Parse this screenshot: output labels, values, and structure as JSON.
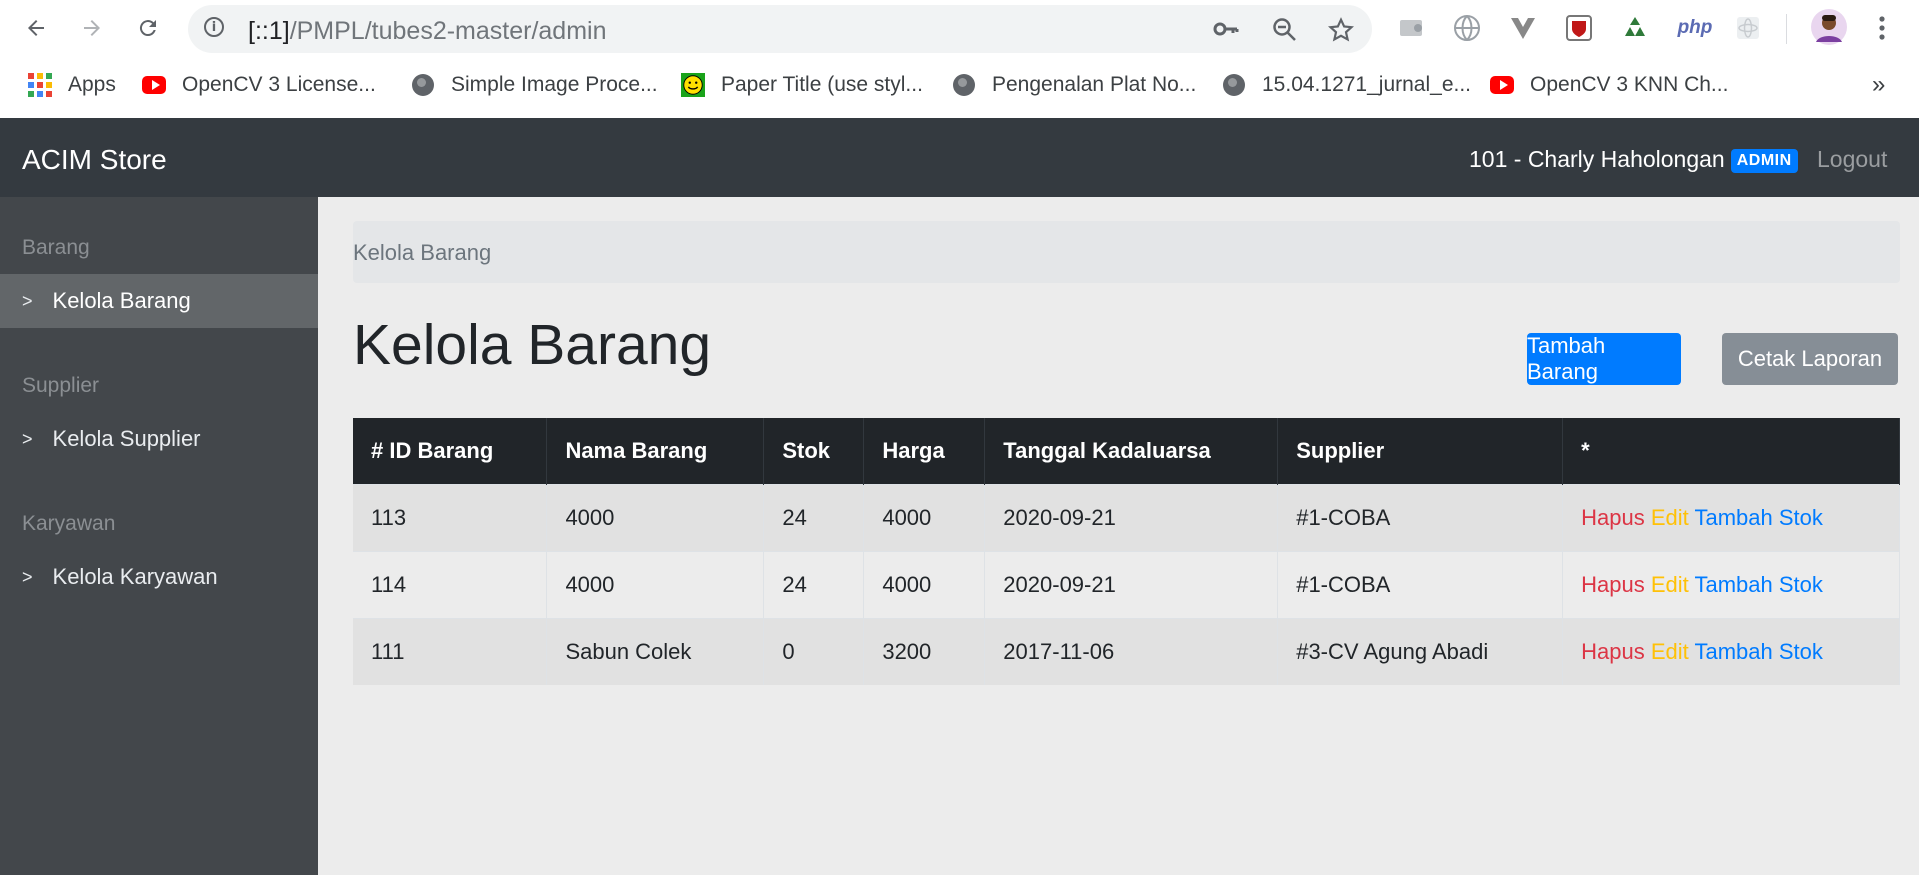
{
  "browser": {
    "url_host": "[::1]",
    "url_path": "/PMPL/tubes2-master/admin",
    "bookmarks": [
      {
        "label": "Apps",
        "icon": "apps-grid-icon"
      },
      {
        "label": "OpenCV 3 License...",
        "icon": "youtube-icon"
      },
      {
        "label": "Simple Image Proce...",
        "icon": "globe-icon"
      },
      {
        "label": "Paper Title (use styl...",
        "icon": "smiley-icon"
      },
      {
        "label": "Pengenalan Plat No...",
        "icon": "globe-icon"
      },
      {
        "label": "15.04.1271_jurnal_e...",
        "icon": "globe-icon"
      },
      {
        "label": "OpenCV 3 KNN Ch...",
        "icon": "youtube-icon"
      }
    ],
    "more": "»",
    "ext_php": "php"
  },
  "navbar": {
    "brand": "ACIM Store",
    "user": "101 - Charly Haholongan",
    "role_badge": "ADMIN",
    "logout": "Logout"
  },
  "sidebar": {
    "sections": [
      {
        "heading": "Barang",
        "item": "Kelola Barang"
      },
      {
        "heading": "Supplier",
        "item": "Kelola Supplier"
      },
      {
        "heading": "Karyawan",
        "item": "Kelola Karyawan"
      }
    ],
    "chevron": ">"
  },
  "main": {
    "breadcrumb": "Kelola Barang",
    "title": "Kelola Barang",
    "add_button": "Tambah Barang",
    "print_button": "Cetak Laporan"
  },
  "table": {
    "headers": [
      "# ID Barang",
      "Nama Barang",
      "Stok",
      "Harga",
      "Tanggal Kadaluarsa",
      "Supplier",
      "*"
    ],
    "rows": [
      {
        "id": "113",
        "nama": "4000",
        "stok": "24",
        "harga": "4000",
        "tanggal": "2020-09-21",
        "supplier": "#1-COBA"
      },
      {
        "id": "114",
        "nama": "4000",
        "stok": "24",
        "harga": "4000",
        "tanggal": "2020-09-21",
        "supplier": "#1-COBA"
      },
      {
        "id": "111",
        "nama": "Sabun Colek",
        "stok": "0",
        "harga": "3200",
        "tanggal": "2017-11-06",
        "supplier": "#3-CV Agung Abadi"
      }
    ],
    "actions": {
      "delete": "Hapus",
      "edit": "Edit",
      "add_stock": "Tambah Stok"
    }
  },
  "colors": {
    "primary": "#007bff",
    "secondary": "#868e96",
    "danger": "#dc3545",
    "warning": "#ffc107",
    "dark": "#343a40"
  }
}
